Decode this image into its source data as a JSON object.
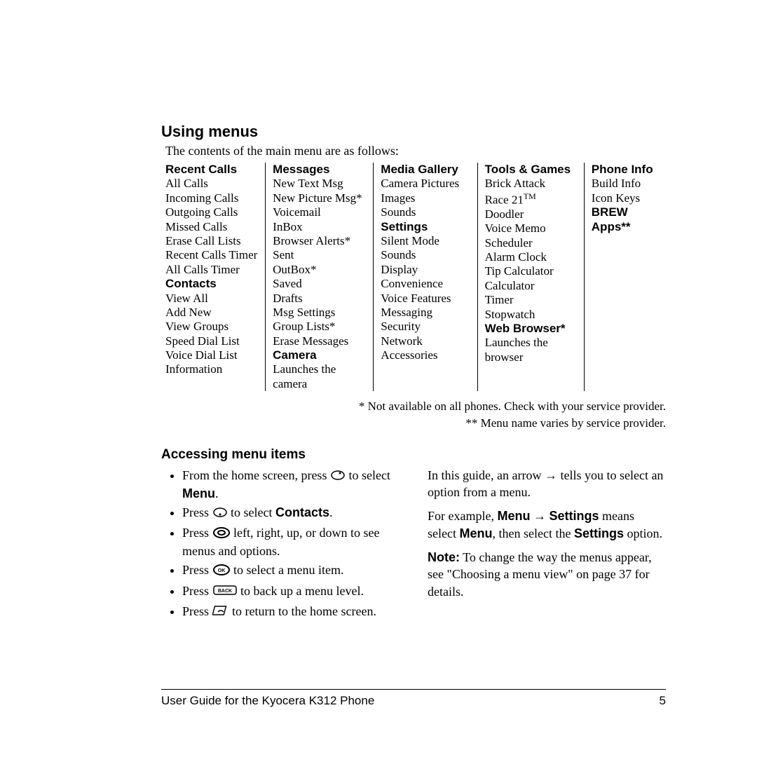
{
  "heading": "Using menus",
  "intro": "The contents of the main menu are as follows:",
  "columns": {
    "c1": {
      "h1": "Recent Calls",
      "i1": "All Calls",
      "i2": "Incoming Calls",
      "i3": "Outgoing Calls",
      "i4": "Missed Calls",
      "i5": "Erase Call Lists",
      "i6": "Recent Calls Timer",
      "i7": "All Calls Timer",
      "h2": "Contacts",
      "j1": "View All",
      "j2": "Add New",
      "j3": "View Groups",
      "j4": "Speed Dial List",
      "j5": "Voice Dial List",
      "j6": "Information"
    },
    "c2": {
      "h1": "Messages",
      "i1": "New Text Msg",
      "i2": "New Picture Msg*",
      "i3": "Voicemail",
      "i4": "InBox",
      "i5": "Browser Alerts*",
      "i6": "Sent",
      "i7": "OutBox*",
      "i8": "Saved",
      "i9": "Drafts",
      "i10": "Msg Settings",
      "i11": "Group Lists*",
      "i12": "Erase Messages",
      "h2": "Camera",
      "j1": "Launches the camera"
    },
    "c3": {
      "h1": "Media Gallery",
      "i1": "Camera Pictures",
      "i2": "Images",
      "i3": "Sounds",
      "h2": "Settings",
      "j1": "Silent Mode",
      "j2": "Sounds",
      "j3": "Display",
      "j4": "Convenience",
      "j5": "Voice Features",
      "j6": "Messaging",
      "j7": "Security",
      "j8": "Network",
      "j9": "Accessories"
    },
    "c4": {
      "h1": "Tools & Games",
      "i1": "Brick Attack",
      "i2a": "Race 21",
      "i2b": "TM",
      "i3": "Doodler",
      "i4": "Voice Memo",
      "i5": "Scheduler",
      "i6": "Alarm Clock",
      "i7": "Tip Calculator",
      "i8": "Calculator",
      "i9": "Timer",
      "i10": "Stopwatch",
      "h2": "Web Browser*",
      "j1": "Launches the browser"
    },
    "c5": {
      "h1": "Phone Info",
      "i1": "Build Info",
      "i2": "Icon Keys",
      "h2": "BREW Apps**"
    }
  },
  "footnote1": "* Not available on all phones. Check with your service provider.",
  "footnote2": "** Menu name varies by service provider.",
  "subheading": "Accessing menu items",
  "bullets": {
    "b1a": "From the home screen, press ",
    "b1b": " to select ",
    "b1c": "Menu",
    "b1d": ".",
    "b2a": "Press ",
    "b2b": " to select ",
    "b2c": "Contacts",
    "b2d": ".",
    "b3a": "Press ",
    "b3b": " left, right, up, or down to see menus and options.",
    "b4a": "Press ",
    "b4b": " to select a menu item.",
    "b5a": "Press ",
    "b5b": " to back up a menu level.",
    "b6a": "Press ",
    "b6b": " to return to the home screen."
  },
  "right": {
    "p1a": "In this guide, an arrow ",
    "p1b": " tells you to select an option from a menu.",
    "p2a": "For example, ",
    "p2b": "Menu",
    "p2c": " → ",
    "p2d": "Settings",
    "p2e": " means select ",
    "p2f": "Menu",
    "p2g": ", then select the ",
    "p2h": "Settings",
    "p2i": " option.",
    "p3a": "Note:",
    "p3b": "  To change the way the menus appear, see \"Choosing a menu view\" on page 37 for details."
  },
  "footer_left": "User Guide for the Kyocera K312 Phone",
  "footer_right": "5"
}
